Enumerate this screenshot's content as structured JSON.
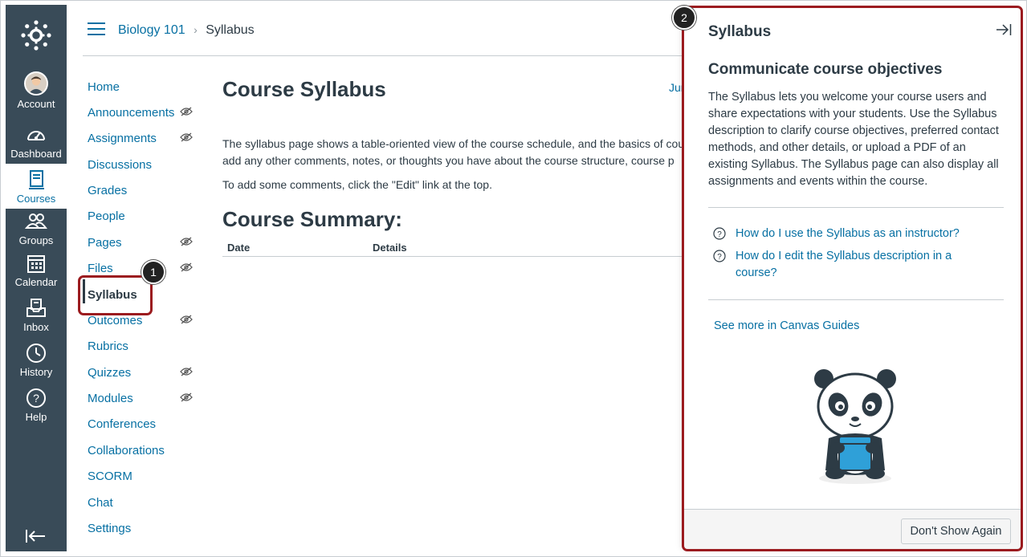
{
  "global_nav": {
    "items": [
      {
        "label": "Account",
        "icon": "account-avatar"
      },
      {
        "label": "Dashboard",
        "icon": "dashboard-icon"
      },
      {
        "label": "Courses",
        "icon": "courses-icon"
      },
      {
        "label": "Groups",
        "icon": "groups-icon"
      },
      {
        "label": "Calendar",
        "icon": "calendar-icon"
      },
      {
        "label": "Inbox",
        "icon": "inbox-icon"
      },
      {
        "label": "History",
        "icon": "history-icon"
      },
      {
        "label": "Help",
        "icon": "help-icon"
      }
    ],
    "active": "Courses"
  },
  "breadcrumb": {
    "course": "Biology 101",
    "separator": "›",
    "current": "Syllabus"
  },
  "course_nav": {
    "items": [
      {
        "label": "Home",
        "hidden": false
      },
      {
        "label": "Announcements",
        "hidden": true
      },
      {
        "label": "Assignments",
        "hidden": true
      },
      {
        "label": "Discussions",
        "hidden": false
      },
      {
        "label": "Grades",
        "hidden": false
      },
      {
        "label": "People",
        "hidden": false
      },
      {
        "label": "Pages",
        "hidden": true
      },
      {
        "label": "Files",
        "hidden": true
      },
      {
        "label": "Syllabus",
        "hidden": false
      },
      {
        "label": "Outcomes",
        "hidden": true
      },
      {
        "label": "Rubrics",
        "hidden": false
      },
      {
        "label": "Quizzes",
        "hidden": true
      },
      {
        "label": "Modules",
        "hidden": true
      },
      {
        "label": "Conferences",
        "hidden": false
      },
      {
        "label": "Collaborations",
        "hidden": false
      },
      {
        "label": "SCORM",
        "hidden": false
      },
      {
        "label": "Chat",
        "hidden": false
      },
      {
        "label": "Settings",
        "hidden": false
      }
    ],
    "active": "Syllabus"
  },
  "callouts": {
    "one": "1",
    "two": "2"
  },
  "main": {
    "title": "Course Syllabus",
    "jump_link": "Jum",
    "description_line1": "The syllabus page shows a table-oriented view of the course schedule, and the basics of cou",
    "description_line2": "add any other comments, notes, or thoughts you have about the course structure, course p",
    "edit_hint": "To add some comments, click the \"Edit\" link at the top.",
    "summary_title": "Course Summary:",
    "table_headers": [
      "Date",
      "Details"
    ]
  },
  "tray": {
    "title": "Syllabus",
    "subtitle": "Communicate course objectives",
    "body": "The Syllabus lets you welcome your course users and share expectations with your students. Use the Syllabus description to clarify course objectives, preferred contact methods, and other details, or upload a PDF of an existing Syllabus. The Syllabus page can also display all assignments and events within the course.",
    "links": [
      "How do I use the Syllabus as an instructor?",
      "How do I edit the Syllabus description in a course?"
    ],
    "guides_link": "See more in Canvas Guides",
    "dont_show_button": "Don't Show Again"
  },
  "colors": {
    "nav_bg": "#394b58",
    "link": "#0770a3",
    "callout": "#9b1b1f"
  }
}
